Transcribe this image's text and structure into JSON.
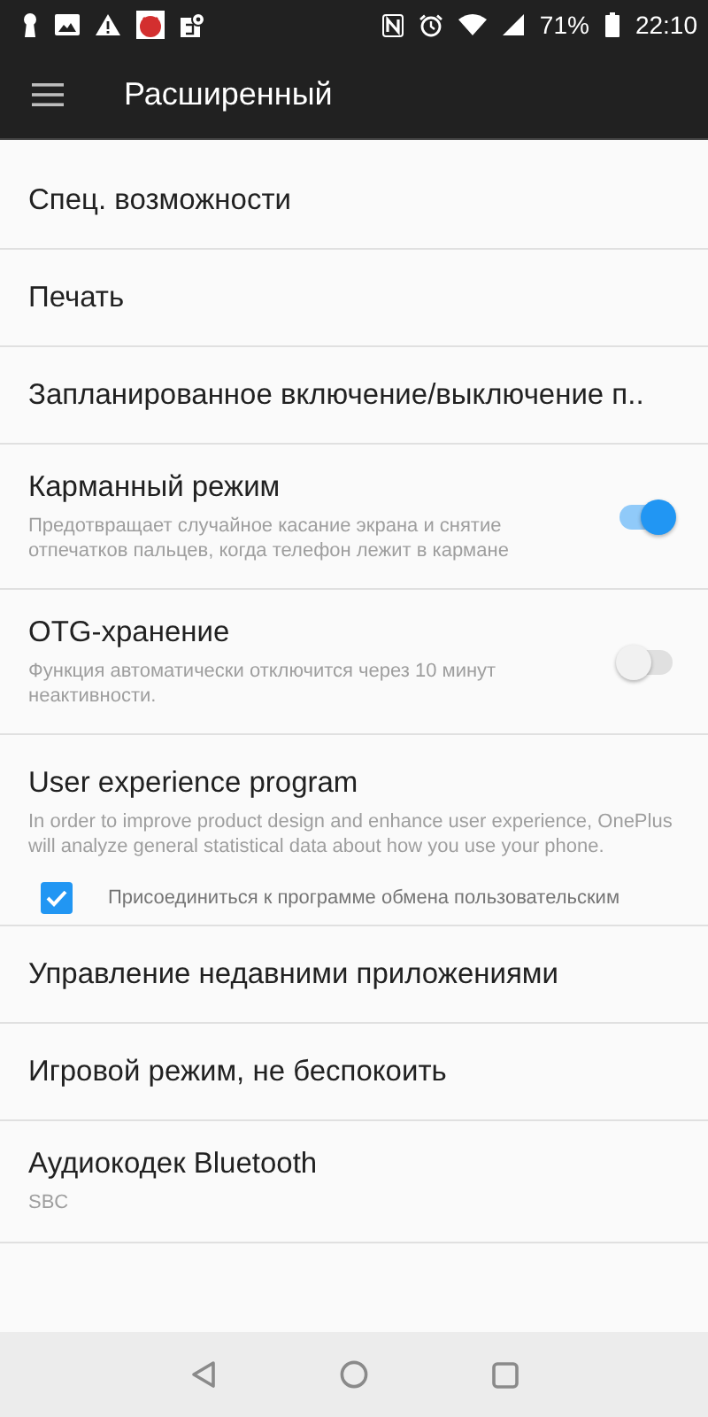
{
  "status_bar": {
    "battery": "71%",
    "time": "22:10"
  },
  "app_bar": {
    "title": "Расширенный"
  },
  "settings": [
    {
      "kind": "plain",
      "title": "Спец. возможности"
    },
    {
      "kind": "plain",
      "title": "Печать"
    },
    {
      "kind": "plain",
      "title": "Запланированное включение/выключение п.."
    },
    {
      "kind": "toggle",
      "title": "Карманный режим",
      "summary": "Предотвращает случайное касание экрана и снятие отпечатков пальцев, когда телефон лежит в кармане",
      "on": true
    },
    {
      "kind": "toggle",
      "title": "OTG-хранение",
      "summary": "Функция автоматически отключится через 10 минут неактивности.",
      "on": false
    },
    {
      "kind": "consent",
      "title": "User experience program",
      "summary": "In order to improve product design and enhance user experience, OnePlus will analyze general statistical data about how you use your phone.",
      "checkbox": {
        "label": "Присоединиться к программе обмена пользовательским",
        "checked": true
      }
    },
    {
      "kind": "plain",
      "title": "Управление недавними приложениями"
    },
    {
      "kind": "plain",
      "title": "Игровой режим, не беспокоить"
    },
    {
      "kind": "plain",
      "title": "Аудиокодек Bluetooth",
      "summary": "SBC"
    }
  ]
}
